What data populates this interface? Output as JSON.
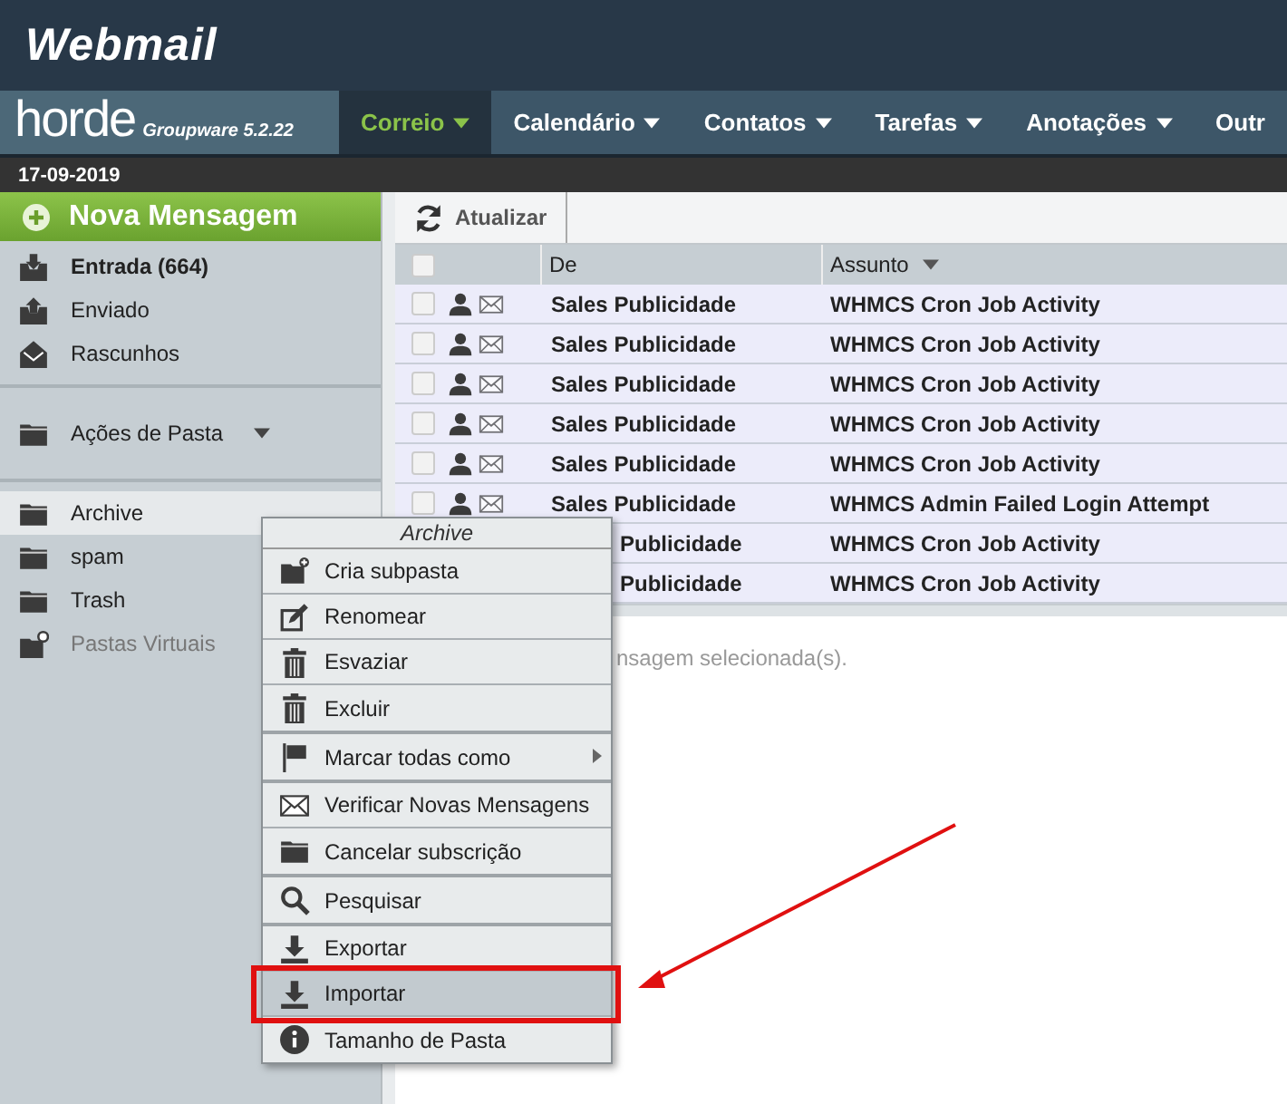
{
  "header": {
    "title": "Webmail"
  },
  "brand": {
    "logo": "horde",
    "product": "Groupware 5.2.22"
  },
  "nav": [
    {
      "label": "Correio",
      "selected": true
    },
    {
      "label": "Calendário",
      "selected": false
    },
    {
      "label": "Contatos",
      "selected": false
    },
    {
      "label": "Tarefas",
      "selected": false
    },
    {
      "label": "Anotações",
      "selected": false
    },
    {
      "label": "Outr",
      "selected": false
    }
  ],
  "date": "17-09-2019",
  "sidebar": {
    "new_message": "Nova Mensagem",
    "mailboxes": [
      {
        "label": "Entrada (664)",
        "unread": true
      },
      {
        "label": "Enviado",
        "unread": false
      },
      {
        "label": "Rascunhos",
        "unread": false
      }
    ],
    "folder_actions": "Ações de Pasta",
    "folders": [
      {
        "label": "Archive",
        "selected": true,
        "disabled": false
      },
      {
        "label": "spam",
        "selected": false,
        "disabled": false
      },
      {
        "label": "Trash",
        "selected": false,
        "disabled": false
      },
      {
        "label": "Pastas Virtuais",
        "selected": false,
        "disabled": true
      }
    ]
  },
  "toolbar": {
    "refresh": "Atualizar"
  },
  "table": {
    "columns": [
      "De",
      "Assunto"
    ],
    "rows": [
      {
        "checked": false,
        "from": "Sales Publicidade",
        "subject": "WHMCS Cron Job Activity"
      },
      {
        "checked": false,
        "from": "Sales Publicidade",
        "subject": "WHMCS Cron Job Activity"
      },
      {
        "checked": false,
        "from": "Sales Publicidade",
        "subject": "WHMCS Cron Job Activity"
      },
      {
        "checked": false,
        "from": "Sales Publicidade",
        "subject": "WHMCS Cron Job Activity"
      },
      {
        "checked": false,
        "from": "Sales Publicidade",
        "subject": "WHMCS Cron Job Activity"
      },
      {
        "checked": false,
        "from": "Sales Publicidade",
        "subject": "WHMCS Admin Failed Login Attempt"
      },
      {
        "from": "Publicidade",
        "subject": "WHMCS Cron Job Activity"
      },
      {
        "from": "Publicidade",
        "subject": "WHMCS Cron Job Activity"
      }
    ],
    "select_all": false
  },
  "preview": {
    "message": "nsagem selecionada(s)."
  },
  "context_menu": {
    "title": "Archive",
    "groups": [
      [
        {
          "label": "Cria subpasta",
          "selected": false,
          "submenu": false
        },
        {
          "label": "Renomear",
          "selected": false,
          "submenu": false
        },
        {
          "label": "Esvaziar",
          "selected": false,
          "submenu": false
        },
        {
          "label": "Excluir",
          "selected": false,
          "submenu": false
        }
      ],
      [
        {
          "label": "Marcar todas como",
          "selected": false,
          "submenu": true
        }
      ],
      [
        {
          "label": "Verificar Novas Mensagens",
          "selected": false,
          "submenu": false
        },
        {
          "label": "Cancelar subscrição",
          "selected": false,
          "submenu": false
        }
      ],
      [
        {
          "label": "Pesquisar",
          "selected": false,
          "submenu": false
        }
      ],
      [
        {
          "label": "Exportar",
          "selected": false,
          "submenu": false
        },
        {
          "label": "Importar",
          "selected": true,
          "submenu": false
        },
        {
          "label": "Tamanho de Pasta",
          "selected": false,
          "submenu": false
        }
      ]
    ]
  }
}
